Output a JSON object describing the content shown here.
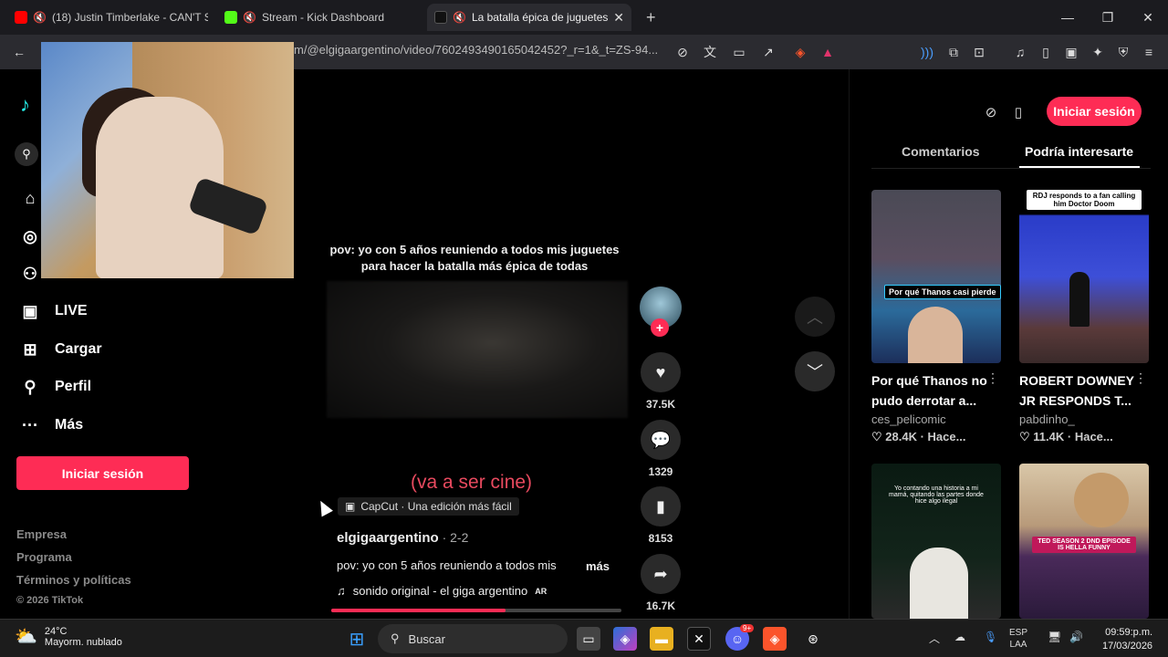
{
  "browser": {
    "tabs": [
      {
        "title": "(18) Justin Timberlake - CAN'T ST",
        "icon": "youtube-icon"
      },
      {
        "title": "Stream - Kick Dashboard",
        "icon": "kick-icon"
      },
      {
        "title": "La batalla épica de juguetes c",
        "icon": "tiktok-icon"
      }
    ],
    "url": "m/@elgigaargentino/video/7602493490165042452?_r=1&_t=ZS-94..."
  },
  "sidebar": {
    "nav": [
      {
        "label": "LIVE"
      },
      {
        "label": "Cargar"
      },
      {
        "label": "Perfil"
      },
      {
        "label": "Más"
      }
    ],
    "login_label": "Iniciar sesión",
    "footer": [
      "Empresa",
      "Programa",
      "Términos y políticas",
      "© 2026 TikTok"
    ]
  },
  "video": {
    "caption_top": "pov: yo con 5 años reuniendo a todos mis juguetes para hacer la batalla más épica de todas",
    "overlay_text": "(va a ser cine)",
    "capcut_label": "CapCut · Una edición más fácil",
    "author": "elgigaargentino",
    "date": " · 2-2",
    "description": "pov: yo con 5 años reuniendo a todos mis",
    "more_label": "más",
    "sound": "sonido original - el giga argentino",
    "sound_suffix": "AR",
    "progress": 0.6,
    "counts": {
      "likes": "37.5K",
      "comments": "1329",
      "saves": "8153",
      "shares": "16.7K"
    }
  },
  "right": {
    "login_label": "Iniciar sesión",
    "tab_comments": "Comentarios",
    "tab_related": "Podría interesarte",
    "cards": [
      {
        "title": "Por qué Thanos no pudo derrotar a...",
        "user": "ces_pelicomic",
        "likes": "28.4K",
        "time": "Hace...",
        "thumb_label": "Por qué Thanos casi pierde"
      },
      {
        "title": "ROBERT DOWNEY JR RESPONDS T...",
        "user": "pabdinho_",
        "likes": "11.4K",
        "time": "Hace...",
        "thumb_label": "RDJ responds to a fan calling him Doctor Doom"
      },
      {
        "thumb_label": "Yo contando una historia a mi mamá, quitando las partes donde hice algo ilegal"
      },
      {
        "thumb_label": "TED SEASON 2 DND EPISODE IS HELLA FUNNY"
      }
    ]
  },
  "taskbar": {
    "weather_temp": "24°C",
    "weather_desc": "Mayorm. nublado",
    "search_label": "Buscar",
    "lang_line1": "ESP",
    "lang_line2": "LAA",
    "time": "09:59:p.m.",
    "date": "17/03/2026",
    "discord_badge": "9+"
  }
}
